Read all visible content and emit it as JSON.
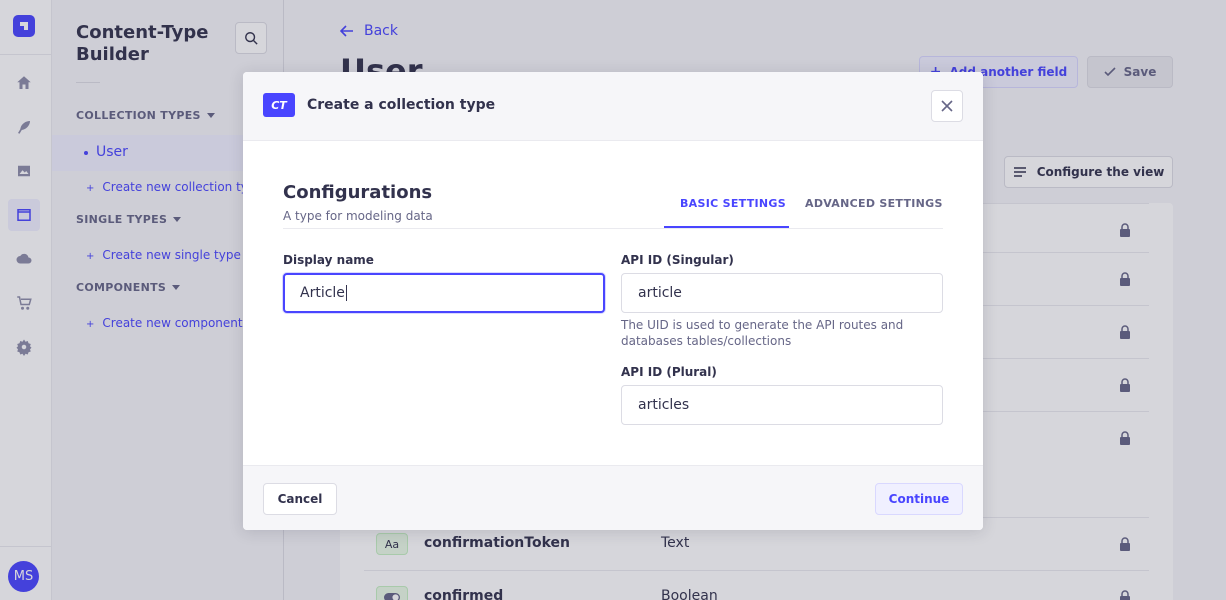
{
  "rail": {
    "avatar_initials": "MS",
    "icons": [
      "home-icon",
      "feather-icon",
      "media-icon",
      "layout-icon",
      "cloud-icon",
      "cart-icon",
      "gear-icon"
    ]
  },
  "subnav": {
    "title": "Content-Type Builder",
    "collection_types": {
      "heading": "COLLECTION TYPES",
      "items": [
        "User"
      ],
      "create_label": "Create new collection type"
    },
    "single_types": {
      "heading": "SINGLE TYPES",
      "create_label": "Create new single type"
    },
    "components": {
      "heading": "COMPONENTS",
      "create_label": "Create new component"
    }
  },
  "main": {
    "back_label": "Back",
    "page_title": "User",
    "add_field_label": "Add another field",
    "save_label": "Save",
    "configure_view_label": "Configure the view",
    "rows": [
      {
        "icon": "Aa",
        "name": "confirmationToken",
        "type": "Text"
      },
      {
        "icon": "toggle",
        "name": "confirmed",
        "type": "Boolean"
      }
    ]
  },
  "modal": {
    "badge": "CT",
    "title": "Create a collection type",
    "section_title": "Configurations",
    "section_subtitle": "A type for modeling data",
    "tabs": {
      "basic": "BASIC SETTINGS",
      "advanced": "ADVANCED SETTINGS"
    },
    "display_name": {
      "label": "Display name",
      "value": "Article"
    },
    "api_singular": {
      "label": "API ID (Singular)",
      "value": "article",
      "hint": "The UID is used to generate the API routes and databases tables/collections"
    },
    "api_plural": {
      "label": "API ID (Plural)",
      "value": "articles"
    },
    "cancel_label": "Cancel",
    "continue_label": "Continue"
  },
  "colors": {
    "primary": "#4945ff",
    "primary_light": "#f0f0ff",
    "text": "#32324d",
    "muted": "#666687"
  }
}
